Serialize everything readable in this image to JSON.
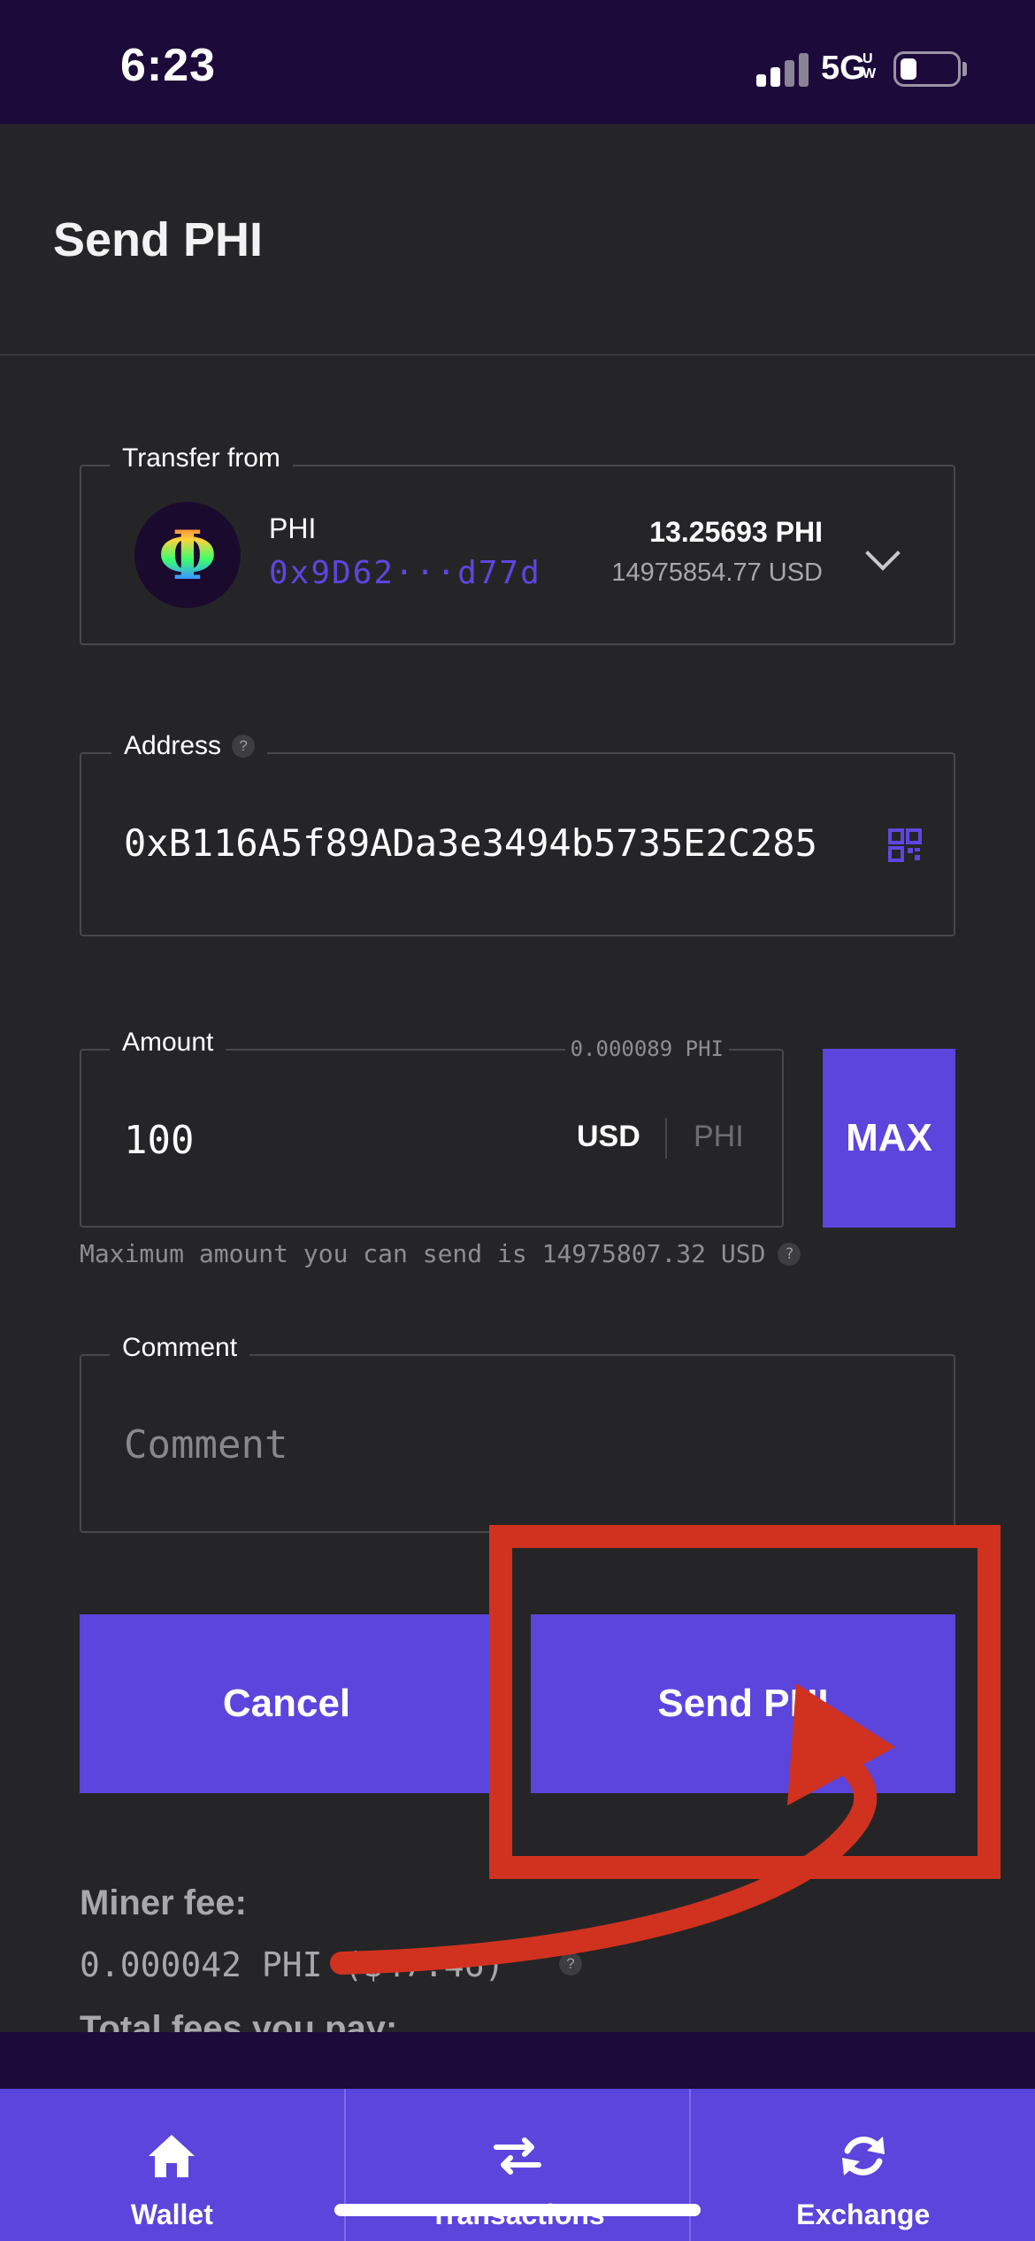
{
  "status_bar": {
    "time": "6:23",
    "network": "5G",
    "network_sub": "UW"
  },
  "header": {
    "title": "Send PHI"
  },
  "transfer_from": {
    "legend": "Transfer from",
    "wallet_name": "PHI",
    "wallet_address": "0x9D62···d77d",
    "balance": "13.25693 PHI",
    "balance_usd": "14975854.77 USD",
    "icon": "phi-logo"
  },
  "address": {
    "legend": "Address",
    "value": "0xB116A5f89ADa3e3494b5735E2C285",
    "help": "?",
    "icon": "qr-code-icon"
  },
  "amount": {
    "legend": "Amount",
    "converted": "0.000089 PHI",
    "value": "100",
    "currency_usd": "USD",
    "currency_phi": "PHI",
    "max_label": "MAX",
    "max_note": "Maximum amount you can send is 14975807.32 USD",
    "help": "?"
  },
  "comment": {
    "legend": "Comment",
    "placeholder": "Comment"
  },
  "actions": {
    "cancel_label": "Cancel",
    "send_label": "Send PHI"
  },
  "fees": {
    "miner_fee_title": "Miner fee:",
    "miner_fee_value": "0.000042 PHI ($47.46)",
    "help": "?",
    "total_title": "Total fees you pay:"
  },
  "bottom_nav": {
    "items": [
      {
        "label": "Wallet",
        "icon": "home-icon"
      },
      {
        "label": "Transactions",
        "icon": "transfer-arrows-icon"
      },
      {
        "label": "Exchange",
        "icon": "refresh-icon"
      }
    ]
  },
  "colors": {
    "accent": "#5b45dc",
    "background": "#252527",
    "status_bar": "#1c0a3a",
    "annotation": "#d0321f"
  }
}
